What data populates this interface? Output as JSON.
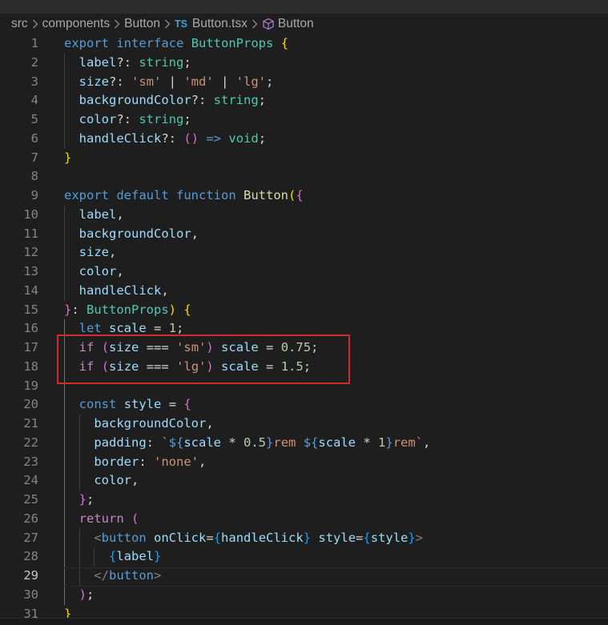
{
  "breadcrumb": {
    "segments": [
      "src",
      "components",
      "Button"
    ],
    "file_badge": "TS",
    "file_name": "Button.tsx",
    "symbol_icon": "cube-icon",
    "symbol_name": "Button"
  },
  "editor": {
    "active_line": 29,
    "highlight": {
      "from_line": 17,
      "to_line": 18,
      "color": "#d32a2a"
    },
    "line_numbers": [
      "1",
      "2",
      "3",
      "4",
      "5",
      "6",
      "7",
      "8",
      "9",
      "10",
      "11",
      "12",
      "13",
      "14",
      "15",
      "16",
      "17",
      "18",
      "19",
      "20",
      "21",
      "22",
      "23",
      "24",
      "25",
      "26",
      "27",
      "28",
      "29",
      "30",
      "31"
    ],
    "lines": [
      [
        [
          "kw",
          "export"
        ],
        [
          "pl",
          " "
        ],
        [
          "kw",
          "interface"
        ],
        [
          "pl",
          " "
        ],
        [
          "type",
          "ButtonProps"
        ],
        [
          "pl",
          " "
        ],
        [
          "b1",
          "{"
        ]
      ],
      [
        [
          "pl",
          "  "
        ],
        [
          "var",
          "label"
        ],
        [
          "pl",
          "?: "
        ],
        [
          "type",
          "string"
        ],
        [
          "pl",
          ";"
        ]
      ],
      [
        [
          "pl",
          "  "
        ],
        [
          "var",
          "size"
        ],
        [
          "pl",
          "?: "
        ],
        [
          "str",
          "'sm'"
        ],
        [
          "pl",
          " | "
        ],
        [
          "str",
          "'md'"
        ],
        [
          "pl",
          " | "
        ],
        [
          "str",
          "'lg'"
        ],
        [
          "pl",
          ";"
        ]
      ],
      [
        [
          "pl",
          "  "
        ],
        [
          "var",
          "backgroundColor"
        ],
        [
          "pl",
          "?: "
        ],
        [
          "type",
          "string"
        ],
        [
          "pl",
          ";"
        ]
      ],
      [
        [
          "pl",
          "  "
        ],
        [
          "var",
          "color"
        ],
        [
          "pl",
          "?: "
        ],
        [
          "type",
          "string"
        ],
        [
          "pl",
          ";"
        ]
      ],
      [
        [
          "pl",
          "  "
        ],
        [
          "var",
          "handleClick"
        ],
        [
          "pl",
          "?: "
        ],
        [
          "b2",
          "()"
        ],
        [
          "pl",
          " "
        ],
        [
          "kw",
          "=>"
        ],
        [
          "pl",
          " "
        ],
        [
          "type",
          "void"
        ],
        [
          "pl",
          ";"
        ]
      ],
      [
        [
          "b1",
          "}"
        ]
      ],
      [],
      [
        [
          "kw",
          "export"
        ],
        [
          "pl",
          " "
        ],
        [
          "kw",
          "default"
        ],
        [
          "pl",
          " "
        ],
        [
          "kw",
          "function"
        ],
        [
          "pl",
          " "
        ],
        [
          "fn",
          "Button"
        ],
        [
          "b1",
          "("
        ],
        [
          "b2",
          "{"
        ]
      ],
      [
        [
          "pl",
          "  "
        ],
        [
          "var",
          "label"
        ],
        [
          "pl",
          ","
        ]
      ],
      [
        [
          "pl",
          "  "
        ],
        [
          "var",
          "backgroundColor"
        ],
        [
          "pl",
          ","
        ]
      ],
      [
        [
          "pl",
          "  "
        ],
        [
          "var",
          "size"
        ],
        [
          "pl",
          ","
        ]
      ],
      [
        [
          "pl",
          "  "
        ],
        [
          "var",
          "color"
        ],
        [
          "pl",
          ","
        ]
      ],
      [
        [
          "pl",
          "  "
        ],
        [
          "var",
          "handleClick"
        ],
        [
          "pl",
          ","
        ]
      ],
      [
        [
          "b2",
          "}"
        ],
        [
          "pl",
          ": "
        ],
        [
          "type",
          "ButtonProps"
        ],
        [
          "b1",
          ")"
        ],
        [
          "pl",
          " "
        ],
        [
          "b1",
          "{"
        ]
      ],
      [
        [
          "pl",
          "  "
        ],
        [
          "kw",
          "let"
        ],
        [
          "pl",
          " "
        ],
        [
          "var",
          "scale"
        ],
        [
          "pl",
          " = "
        ],
        [
          "num",
          "1"
        ],
        [
          "pl",
          ";"
        ]
      ],
      [
        [
          "pl",
          "  "
        ],
        [
          "ctrl",
          "if"
        ],
        [
          "pl",
          " "
        ],
        [
          "b2",
          "("
        ],
        [
          "var",
          "size"
        ],
        [
          "pl",
          " === "
        ],
        [
          "str",
          "'sm'"
        ],
        [
          "b2",
          ")"
        ],
        [
          "pl",
          " "
        ],
        [
          "var",
          "scale"
        ],
        [
          "pl",
          " = "
        ],
        [
          "num",
          "0.75"
        ],
        [
          "pl",
          ";"
        ]
      ],
      [
        [
          "pl",
          "  "
        ],
        [
          "ctrl",
          "if"
        ],
        [
          "pl",
          " "
        ],
        [
          "b2",
          "("
        ],
        [
          "var",
          "size"
        ],
        [
          "pl",
          " === "
        ],
        [
          "str",
          "'lg'"
        ],
        [
          "b2",
          ")"
        ],
        [
          "pl",
          " "
        ],
        [
          "var",
          "scale"
        ],
        [
          "pl",
          " = "
        ],
        [
          "num",
          "1.5"
        ],
        [
          "pl",
          ";"
        ]
      ],
      [],
      [
        [
          "pl",
          "  "
        ],
        [
          "kw",
          "const"
        ],
        [
          "pl",
          " "
        ],
        [
          "var",
          "style"
        ],
        [
          "pl",
          " = "
        ],
        [
          "b2",
          "{"
        ]
      ],
      [
        [
          "pl",
          "    "
        ],
        [
          "var",
          "backgroundColor"
        ],
        [
          "pl",
          ","
        ]
      ],
      [
        [
          "pl",
          "    "
        ],
        [
          "var",
          "padding"
        ],
        [
          "pl",
          ": "
        ],
        [
          "str",
          "`"
        ],
        [
          "kw",
          "${"
        ],
        [
          "var",
          "scale"
        ],
        [
          "pl",
          " * "
        ],
        [
          "num",
          "0.5"
        ],
        [
          "kw",
          "}"
        ],
        [
          "str",
          "rem "
        ],
        [
          "kw",
          "${"
        ],
        [
          "var",
          "scale"
        ],
        [
          "pl",
          " * "
        ],
        [
          "num",
          "1"
        ],
        [
          "kw",
          "}"
        ],
        [
          "str",
          "rem`"
        ],
        [
          "pl",
          ","
        ]
      ],
      [
        [
          "pl",
          "    "
        ],
        [
          "var",
          "border"
        ],
        [
          "pl",
          ": "
        ],
        [
          "str",
          "'none'"
        ],
        [
          "pl",
          ","
        ]
      ],
      [
        [
          "pl",
          "    "
        ],
        [
          "var",
          "color"
        ],
        [
          "pl",
          ","
        ]
      ],
      [
        [
          "pl",
          "  "
        ],
        [
          "b2",
          "}"
        ],
        [
          "pl",
          ";"
        ]
      ],
      [
        [
          "pl",
          "  "
        ],
        [
          "ctrl",
          "return"
        ],
        [
          "pl",
          " "
        ],
        [
          "b2",
          "("
        ]
      ],
      [
        [
          "pl",
          "    "
        ],
        [
          "tagp",
          "<"
        ],
        [
          "tag",
          "button"
        ],
        [
          "pl",
          " "
        ],
        [
          "attr",
          "onClick"
        ],
        [
          "pl",
          "="
        ],
        [
          "b3",
          "{"
        ],
        [
          "var",
          "handleClick"
        ],
        [
          "b3",
          "}"
        ],
        [
          "pl",
          " "
        ],
        [
          "attr",
          "style"
        ],
        [
          "pl",
          "="
        ],
        [
          "b3",
          "{"
        ],
        [
          "var",
          "style"
        ],
        [
          "b3",
          "}"
        ],
        [
          "tagp",
          ">"
        ]
      ],
      [
        [
          "pl",
          "      "
        ],
        [
          "b3",
          "{"
        ],
        [
          "var",
          "label"
        ],
        [
          "b3",
          "}"
        ]
      ],
      [
        [
          "pl",
          "    "
        ],
        [
          "tagp",
          "</"
        ],
        [
          "tag",
          "button"
        ],
        [
          "tagp",
          ">"
        ]
      ],
      [
        [
          "pl",
          "  "
        ],
        [
          "b2",
          ")"
        ],
        [
          "pl",
          ";"
        ]
      ],
      [
        [
          "b1",
          "}"
        ]
      ]
    ]
  },
  "colors": {
    "background": "#1e1e1e",
    "keyword": "#569cd6",
    "control": "#c586c0",
    "type": "#4ec9b0",
    "function": "#dcdcaa",
    "variable": "#9cdcfe",
    "string": "#ce9178",
    "number": "#b5cea8",
    "bracket_1": "#ffd700",
    "bracket_2": "#da70d6",
    "bracket_3": "#179fff"
  }
}
